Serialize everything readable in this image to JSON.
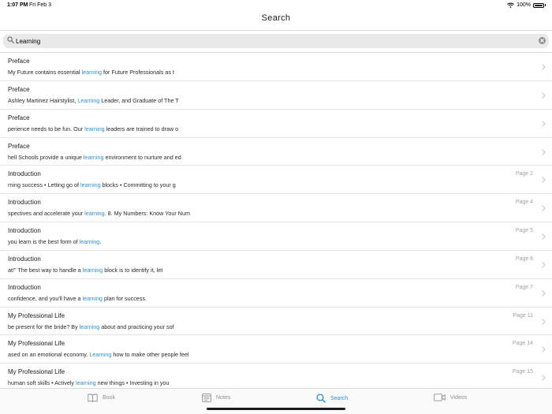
{
  "status_bar": {
    "time": "1:07 PM",
    "date": "Fri Feb 3",
    "battery": "100%"
  },
  "nav": {
    "title": "Search"
  },
  "search": {
    "value": "Learning"
  },
  "colors": {
    "accent": "#2e8fcb",
    "muted": "#8e8e93"
  },
  "results": [
    {
      "title": "Preface",
      "page": "",
      "before": "My Future contains essential ",
      "match": "learning",
      "after": " for Future Professionals as t"
    },
    {
      "title": "Preface",
      "page": "",
      "before": "Ashley Martinez Hairstylist, ",
      "match": "Learning",
      "after": " Leader, and Graduate of The T"
    },
    {
      "title": "Preface",
      "page": "",
      "before": "perience needs to be fun. Our ",
      "match": "learning",
      "after": " leaders are trained to draw o"
    },
    {
      "title": "Preface",
      "page": "",
      "before": "hell Schools provide a unique ",
      "match": "learning",
      "after": " environment to nurture and ed"
    },
    {
      "title": "Introduction",
      "page": "Page 2",
      "before": "rning success • Letting go of ",
      "match": "learning",
      "after": " blocks • Committing to your g"
    },
    {
      "title": "Introduction",
      "page": "Page 4",
      "before": "spectives and accelerate your ",
      "match": "learning",
      "after": ". 8. My Numbers: Know Your Num"
    },
    {
      "title": "Introduction",
      "page": "Page 5",
      "before": "you learn is the best form of ",
      "match": "learning",
      "after": "."
    },
    {
      "title": "Introduction",
      "page": "Page 6",
      "before": "at!\" The best way to handle a ",
      "match": "learning",
      "after": " block is to identify it, let"
    },
    {
      "title": "Introduction",
      "page": "Page 7",
      "before": "confidence, and you'll have a ",
      "match": "learning",
      "after": " plan for success."
    },
    {
      "title": "My Professional Life",
      "page": "Page 11",
      "before": "be present for the bride? By ",
      "match": "learning",
      "after": " about and practicing your sof"
    },
    {
      "title": "My Professional Life",
      "page": "Page 14",
      "before": "ased on an emotional economy. ",
      "match": "Learning",
      "after": " how to make other people feel"
    },
    {
      "title": "My Professional Life",
      "page": "Page 15",
      "before": "human soft skills • Actively ",
      "match": "learning",
      "after": " new things • Investing in you"
    }
  ],
  "tabs": [
    {
      "label": "Book",
      "icon": "book-icon"
    },
    {
      "label": "Notes",
      "icon": "notes-icon"
    },
    {
      "label": "Search",
      "icon": "search-icon"
    },
    {
      "label": "Videos",
      "icon": "video-icon"
    }
  ]
}
